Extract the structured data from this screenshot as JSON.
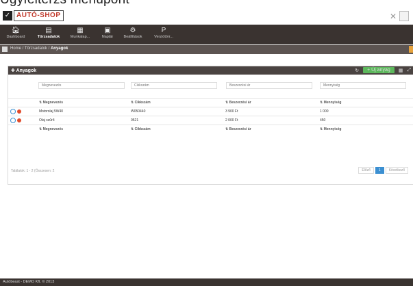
{
  "page_heading": "Ügyfélterzs menüpont",
  "app": {
    "logo_text": "AUTÓ-SHOP"
  },
  "nav": {
    "items": [
      {
        "label": "Dashboard",
        "icon": "🏠︎"
      },
      {
        "label": "Törzsadatok",
        "icon": "▤"
      },
      {
        "label": "Munkalap...",
        "icon": "▦"
      },
      {
        "label": "Naptár",
        "icon": "▣"
      },
      {
        "label": "Beállítások",
        "icon": "⚙"
      },
      {
        "label": "Verziótörr...",
        "icon": "P"
      }
    ]
  },
  "breadcrumb": {
    "home": "Home",
    "section": "Törzsadatok",
    "current": "Anyagok"
  },
  "panel": {
    "title": "Anyagok",
    "new_button": "+ Új anyag"
  },
  "filters": {
    "placeholders": [
      "Megnevezés",
      "Cikkszám",
      "Beszerzési ár",
      "Mennyiség"
    ]
  },
  "table": {
    "headers": [
      "Megnevezés",
      "Cikkszám",
      "Beszerzési ár",
      "Mennyiség"
    ],
    "rows": [
      [
        "Motorolaj 5W40",
        "W050440",
        "3 900 Ft",
        "1 000"
      ],
      [
        "Olaj szűrő",
        "0521",
        "2 000 Ft",
        "450"
      ]
    ]
  },
  "footer_info": "Találatok: 1 - 2 (Összesen: 2",
  "pager": {
    "prev": "Előző",
    "page": "1",
    "next": "Következő"
  },
  "app_footer": "Autóbeast - DEMO Kft. © 2013"
}
